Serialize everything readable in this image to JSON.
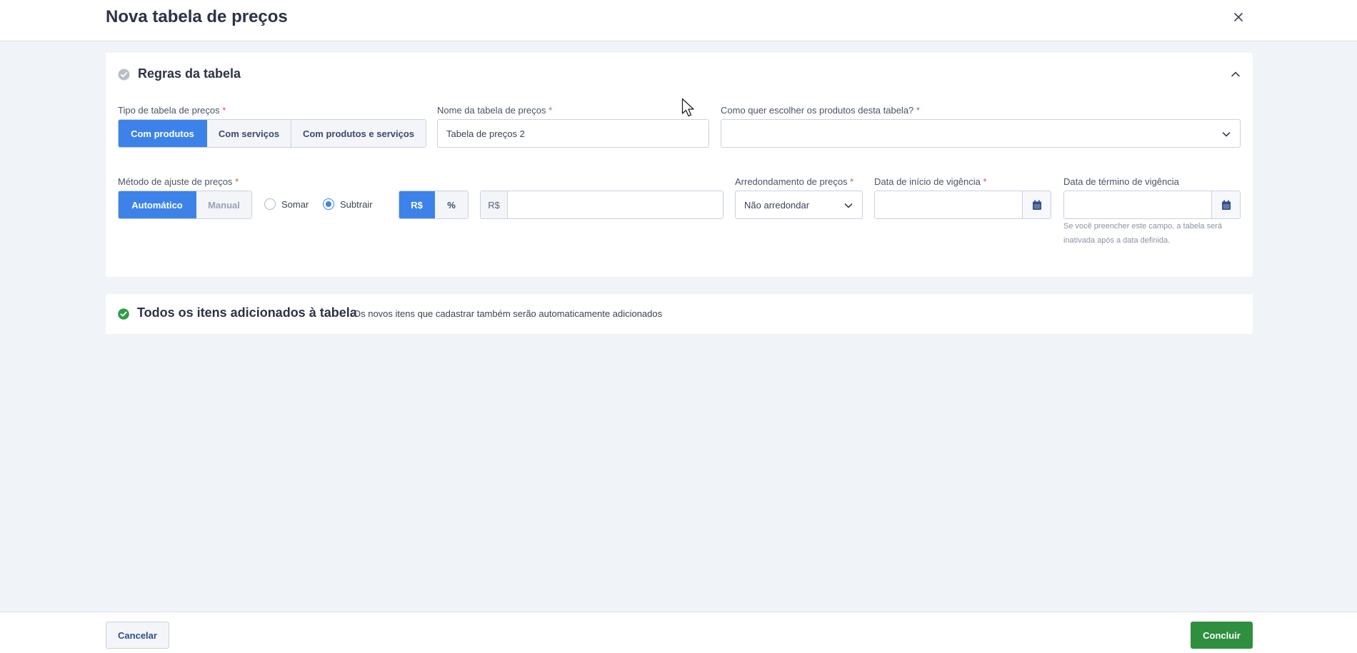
{
  "header": {
    "title": "Nova tabela de preços",
    "close_icon": "close-icon"
  },
  "rules_card": {
    "title": "Regras da tabela",
    "status_icon": "check-circle-icon",
    "collapse_icon": "chevron-up-icon",
    "price_type": {
      "label": "Tipo de tabela de preços",
      "required": "*",
      "options": [
        "Com produtos",
        "Com serviços",
        "Com produtos e serviços"
      ],
      "selected": "Com produtos"
    },
    "table_name": {
      "label": "Nome da tabela de preços",
      "required": "*",
      "value": "Tabela de preços 2"
    },
    "product_choice": {
      "label": "Como quer escolher os produtos desta tabela?",
      "required": "*",
      "value": ""
    },
    "adjust_method": {
      "label": "Método de ajuste de preços",
      "required": "*",
      "options": [
        "Automático",
        "Manual"
      ],
      "selected": "Automático"
    },
    "operation": {
      "options": [
        "Somar",
        "Subtrair"
      ],
      "selected": "Subtrair"
    },
    "unit": {
      "options": [
        "R$",
        "%"
      ],
      "selected": "R$"
    },
    "amount": {
      "prefix": "R$",
      "value": ""
    },
    "rounding": {
      "label": "Arredondamento de preços",
      "required": "*",
      "value": "Não arredondar"
    },
    "start_date": {
      "label": "Data de início de vigência",
      "required": "*",
      "value": ""
    },
    "end_date": {
      "label": "Data de término de vigência",
      "value": "",
      "hint": "Se você preencher este campo, a tabela será inativada após a data definida."
    }
  },
  "items_card": {
    "title": "Todos os itens adicionados à tabela",
    "subtitle": "Os novos itens que cadastrar também serão automaticamente adicionados",
    "status_icon": "check-circle-icon",
    "status_color": "#2f9e44"
  },
  "footer": {
    "cancel_label": "Cancelar",
    "done_label": "Concluir"
  },
  "colors": {
    "accent": "#3d82e8",
    "success": "#2f8f3f",
    "required": "#d9534f"
  }
}
